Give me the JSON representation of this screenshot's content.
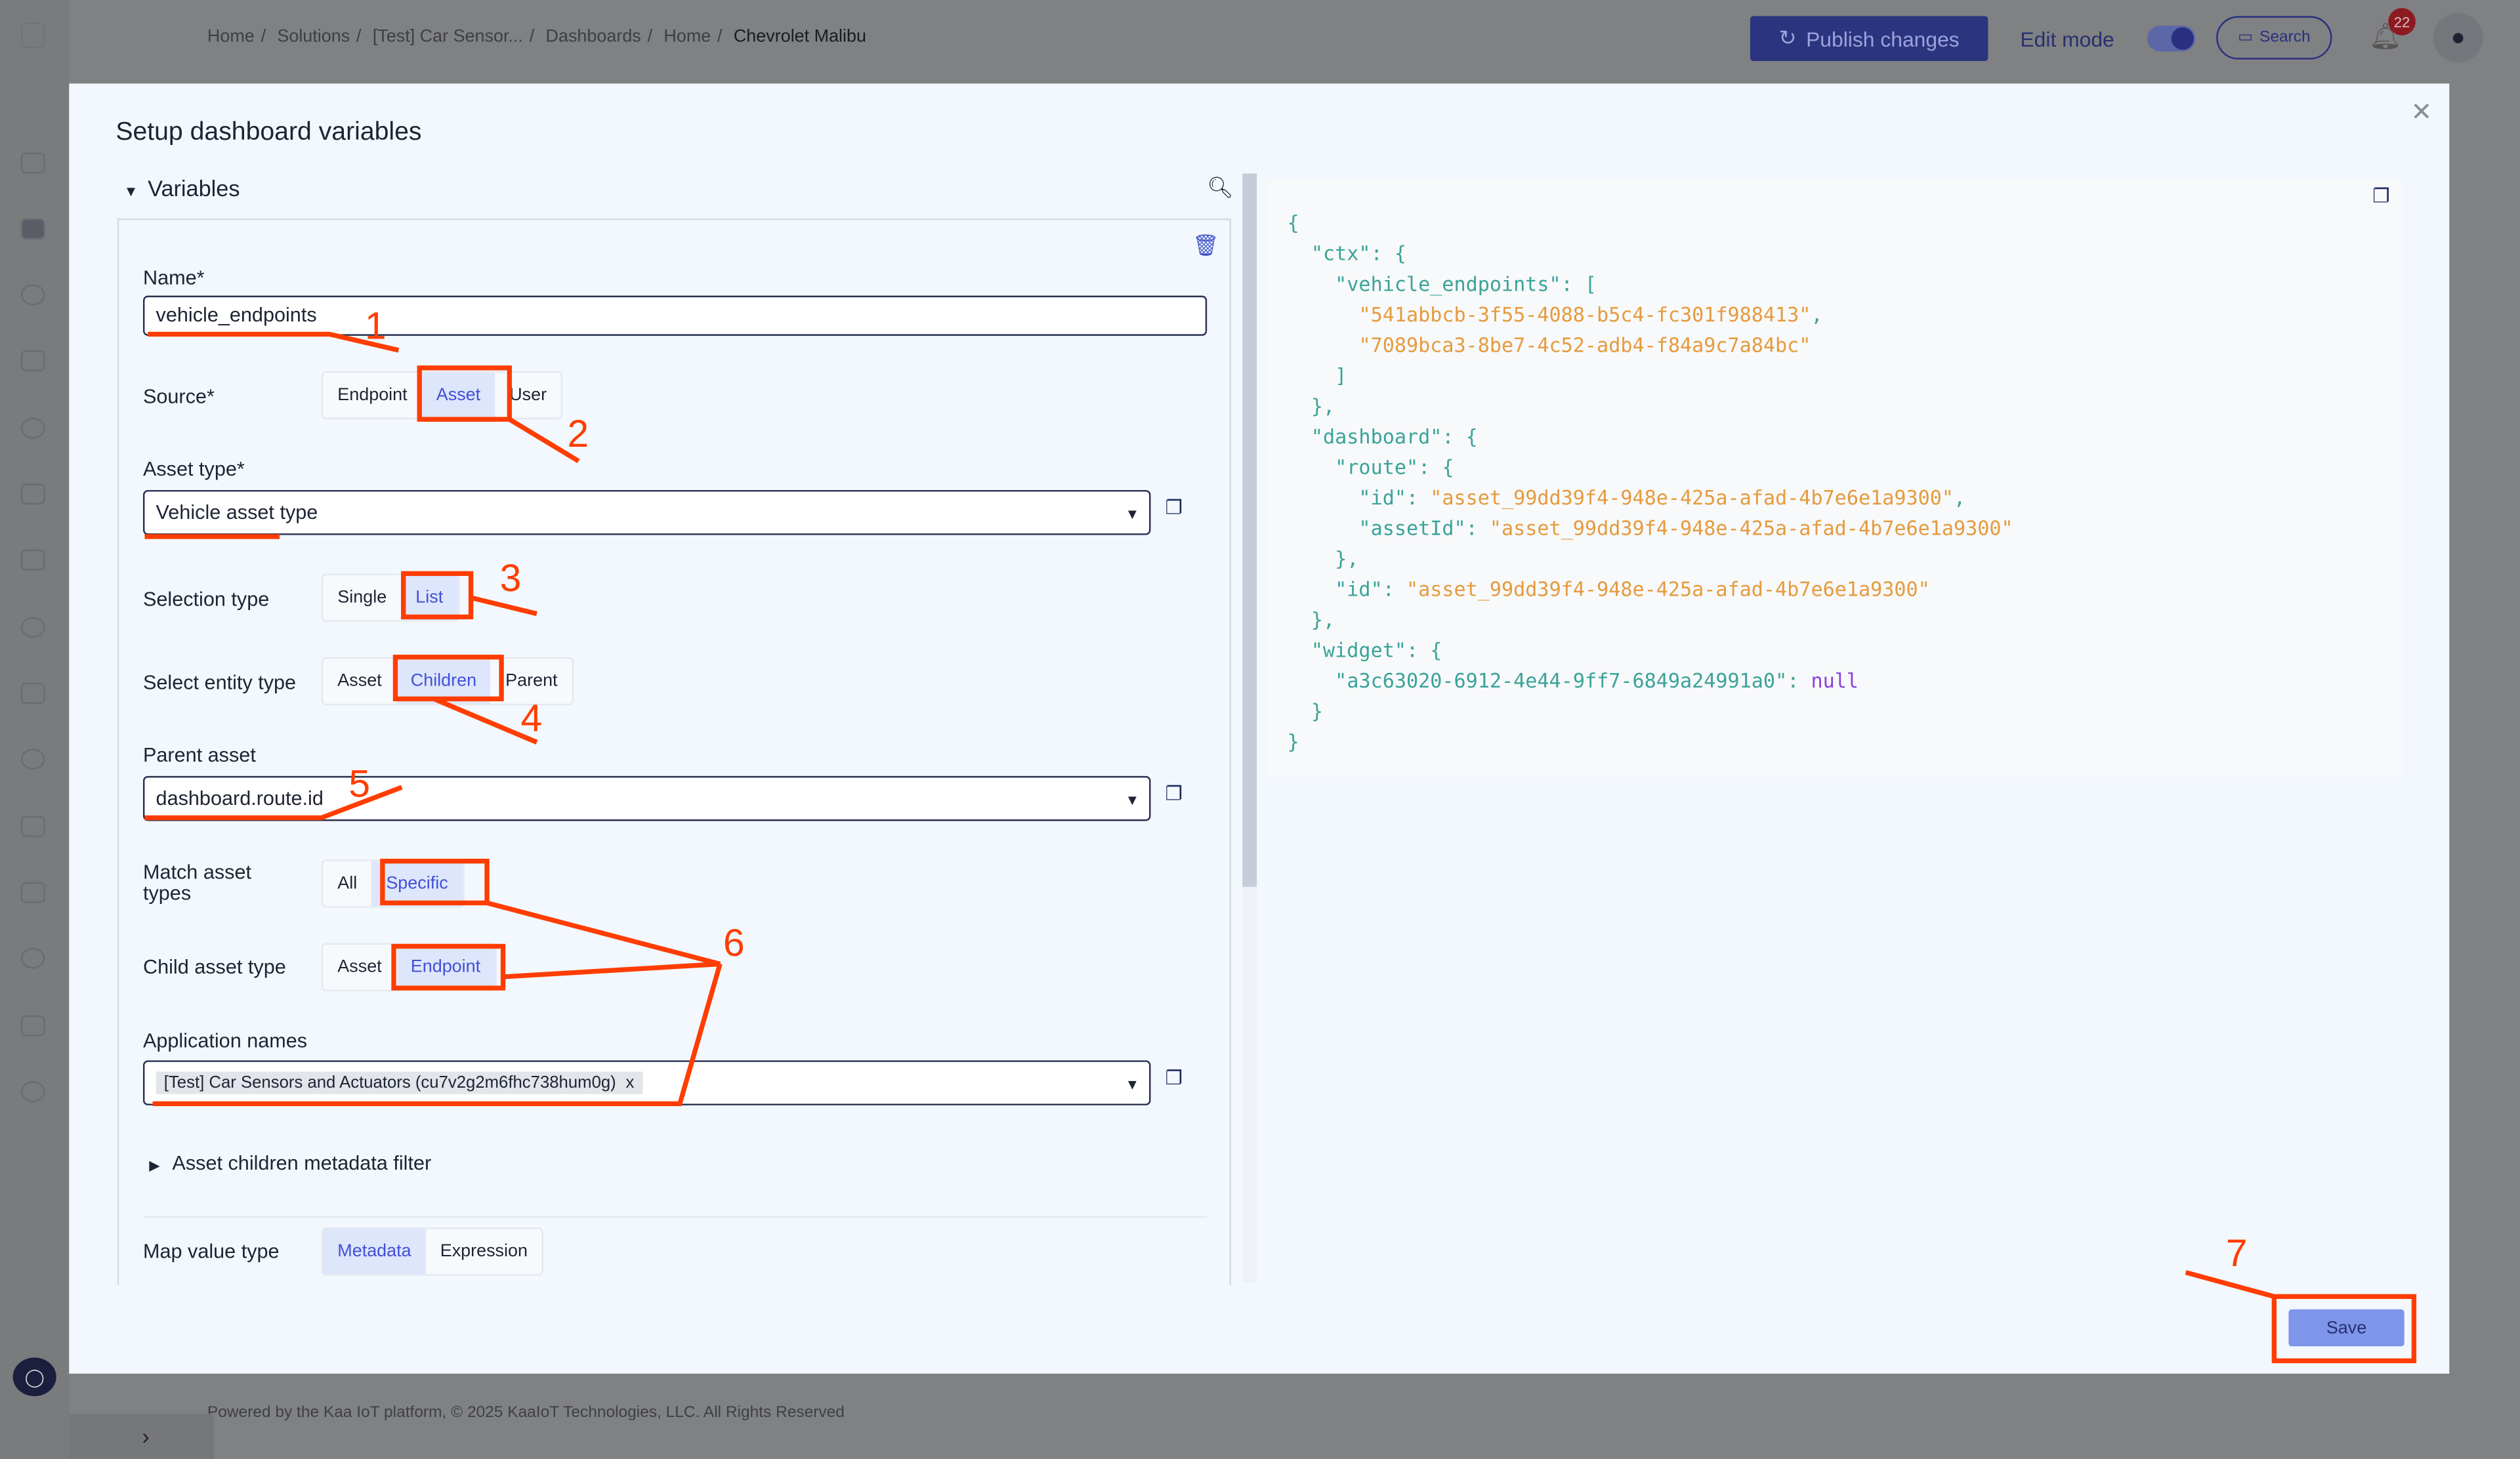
{
  "app": {
    "breadcrumb": [
      "Home",
      "Solutions",
      "[Test] Car Sensor...",
      "Dashboards",
      "Home",
      "Chevrolet Malibu"
    ],
    "publish_label": "Publish changes",
    "edit_mode_label": "Edit mode",
    "edit_mode_on": true,
    "search_label": "Search",
    "notification_count": "22",
    "footer": "Powered by the Kaa IoT platform, © 2025 KaaIoT Technologies, LLC. All Rights Reserved"
  },
  "modal": {
    "title": "Setup dashboard variables",
    "section_label": "Variables",
    "fields": {
      "name_label": "Name*",
      "name_value": "vehicle_endpoints",
      "source_label": "Source*",
      "source_options": [
        "Endpoint",
        "Asset",
        "User"
      ],
      "source_selected": "Asset",
      "asset_type_label": "Asset type*",
      "asset_type_value": "Vehicle asset type",
      "selection_type_label": "Selection type",
      "selection_type_options": [
        "Single",
        "List"
      ],
      "selection_type_selected": "List",
      "entity_type_label": "Select entity type",
      "entity_type_options": [
        "Asset",
        "Children",
        "Parent"
      ],
      "entity_type_selected": "Children",
      "parent_asset_label": "Parent asset",
      "parent_asset_value": "dashboard.route.id",
      "match_label": "Match asset types",
      "match_options": [
        "All",
        "Specific"
      ],
      "match_selected": "Specific",
      "child_type_label": "Child asset type",
      "child_type_options": [
        "Asset",
        "Endpoint"
      ],
      "child_type_selected": "Endpoint",
      "app_names_label": "Application names",
      "app_names_chip": "[Test] Car Sensors and Actuators (cu7v2g2m6fhc738hum0g)",
      "chip_remove": "x",
      "metadata_filter_label": "Asset children metadata filter",
      "map_value_label": "Map value type",
      "map_value_options": [
        "Metadata",
        "Expression"
      ],
      "map_value_selected": "Metadata"
    },
    "json_preview": {
      "vehicle_endpoints": [
        "541abbcb-3f55-4088-b5c4-fc301f988413",
        "7089bca3-8be7-4c52-adb4-f84a9c7a84bc"
      ],
      "route_id": "asset_99dd39f4-948e-425a-afad-4b7e6e1a9300",
      "route_assetId": "asset_99dd39f4-948e-425a-afad-4b7e6e1a9300",
      "dashboard_id": "asset_99dd39f4-948e-425a-afad-4b7e6e1a9300",
      "widget_key": "a3c63020-6912-4e44-9ff7-6849a24991a0",
      "widget_value": "null"
    },
    "save_label": "Save"
  },
  "annotations": {
    "color": "#ff3d00",
    "labels": [
      "1",
      "2",
      "3",
      "4",
      "5",
      "6",
      "7"
    ]
  },
  "colors": {
    "accent": "#4350d6",
    "selected_bg": "#dde6fb",
    "publish_bg": "#2b347f"
  }
}
